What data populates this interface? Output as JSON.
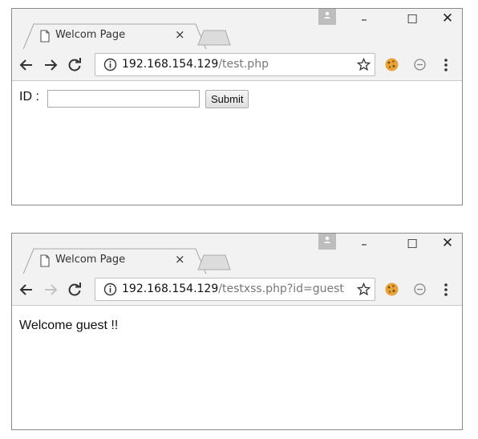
{
  "windows": [
    {
      "tab": {
        "title": "Welcom Page",
        "close": "×"
      },
      "controls": {
        "minimize": "–",
        "maximize": "☐",
        "close": "✕"
      },
      "url": {
        "host": "192.168.154.129",
        "path": "/test.php"
      },
      "forward_enabled": true,
      "form": {
        "label": "ID :",
        "input_value": "",
        "submit_label": "Submit"
      }
    },
    {
      "tab": {
        "title": "Welcom Page",
        "close": "×"
      },
      "controls": {
        "minimize": "–",
        "maximize": "☐",
        "close": "✕"
      },
      "url": {
        "host": "192.168.154.129",
        "path": "/testxss.php?id=guest"
      },
      "forward_enabled": false,
      "message": "Welcome guest !!"
    }
  ],
  "icons": [
    "page-icon",
    "profile-icon",
    "back-arrow-icon",
    "forward-arrow-icon",
    "reload-icon",
    "info-icon",
    "star-icon",
    "cookie-icon",
    "block-icon",
    "menu-icon"
  ],
  "colors": {
    "chrome": "#f2f2f2",
    "border": "#8a8a8a",
    "cookie": "#e8a23a",
    "disabled_arrow": "#c2c2c2"
  }
}
